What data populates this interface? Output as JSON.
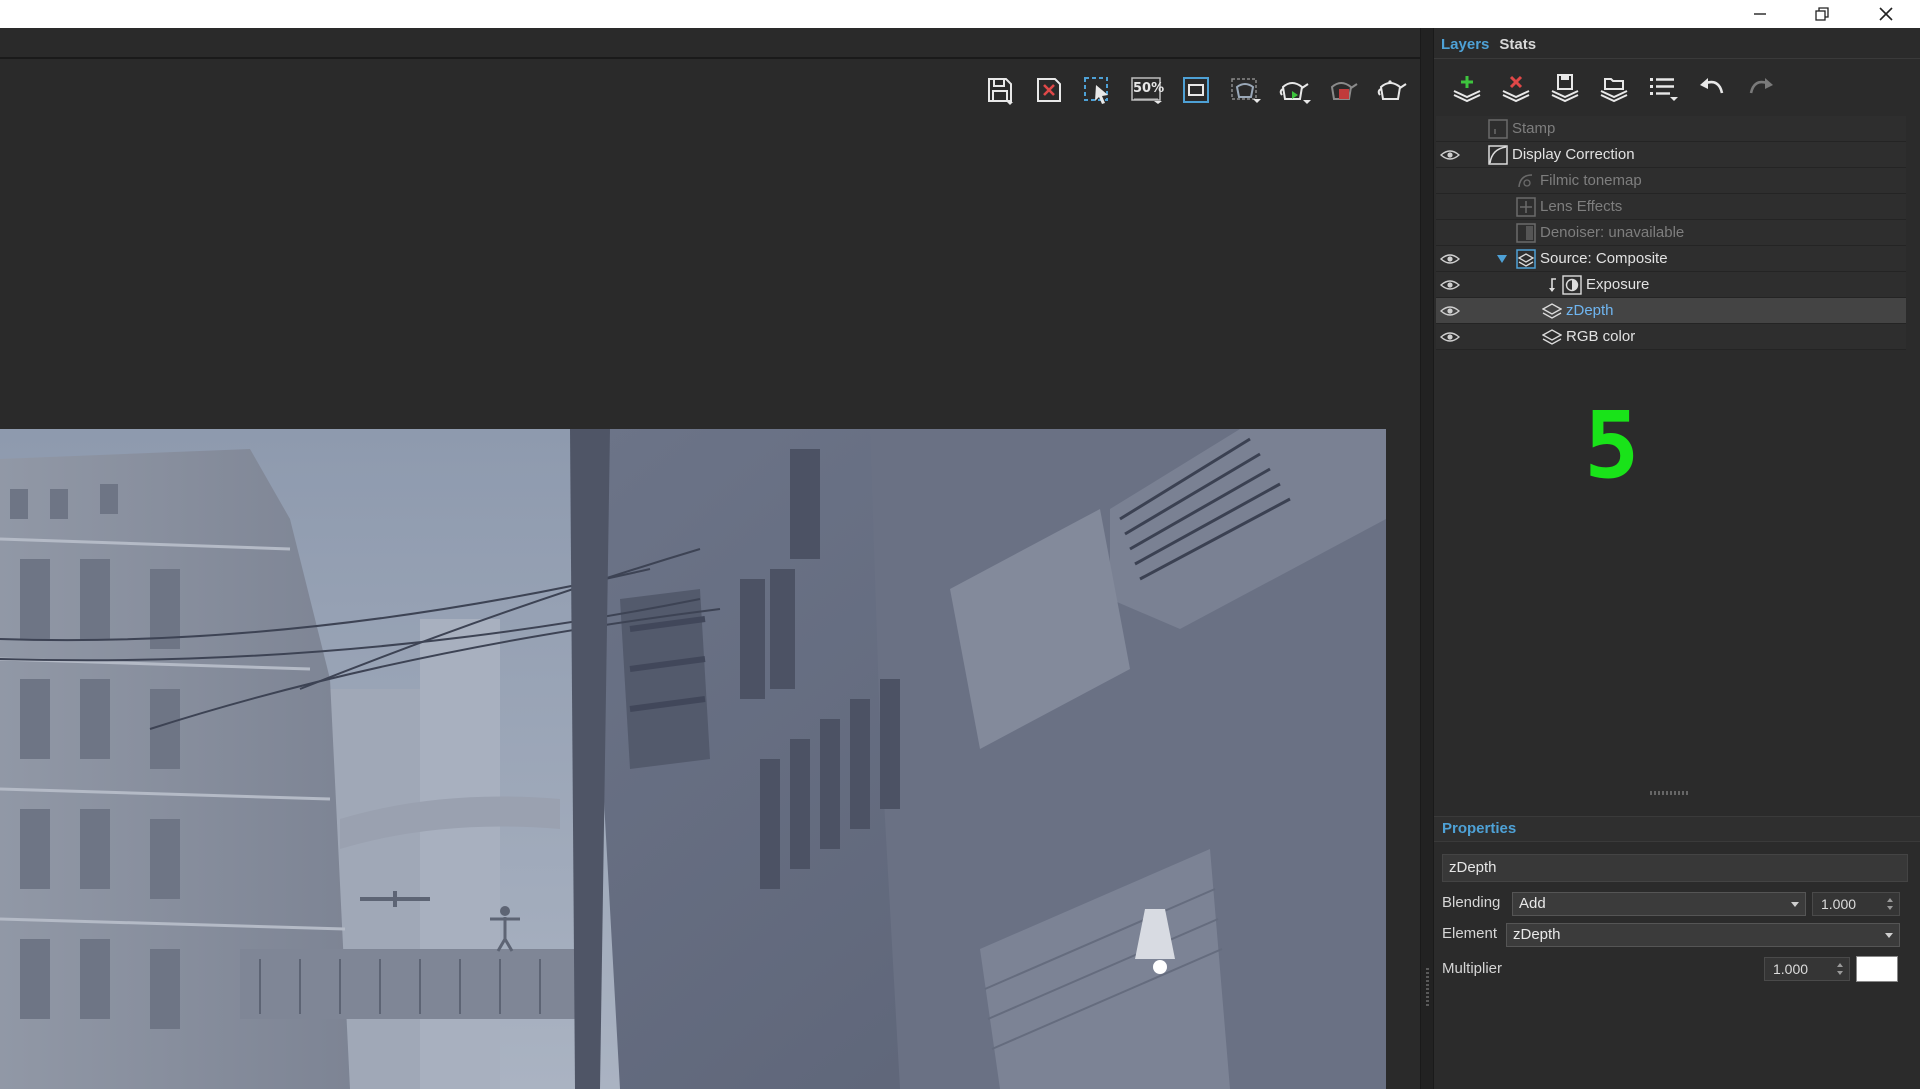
{
  "window": {
    "buttons": [
      "minimize-icon",
      "restore-icon",
      "close-icon"
    ]
  },
  "viewport": {
    "toolbar": [
      {
        "name": "save-image",
        "icon": "floppy-disk-icon"
      },
      {
        "name": "clear-image",
        "icon": "clear-icon"
      },
      {
        "name": "region-select",
        "icon": "region-select-icon"
      },
      {
        "name": "zoom",
        "label": "50%",
        "icon": "zoom-percent-icon"
      },
      {
        "name": "fit-frame",
        "icon": "frame-icon"
      },
      {
        "name": "render-region",
        "icon": "teapot-region-icon"
      },
      {
        "name": "render",
        "icon": "teapot-render-icon"
      },
      {
        "name": "stop-render",
        "icon": "teapot-stop-icon"
      },
      {
        "name": "render-options",
        "icon": "teapot-icon"
      }
    ]
  },
  "panel": {
    "tabs": [
      {
        "label": "Layers",
        "active": true
      },
      {
        "label": "Stats",
        "active": false
      }
    ],
    "layer_toolbar": [
      "add-layer-icon",
      "delete-layer-icon",
      "save-layers-icon",
      "load-layers-icon",
      "layer-list-icon",
      "undo-icon",
      "redo-icon"
    ],
    "layers": [
      {
        "label": "Stamp",
        "visible": false,
        "enabled": false,
        "icon": "stamp-icon"
      },
      {
        "label": "Display Correction",
        "visible": true,
        "enabled": true,
        "icon": "curve-icon"
      },
      {
        "label": "Filmic tonemap",
        "visible": false,
        "enabled": false,
        "icon": "tonemap-icon"
      },
      {
        "label": "Lens Effects",
        "visible": false,
        "enabled": false,
        "icon": "lens-effects-icon"
      },
      {
        "label": "Denoiser: unavailable",
        "visible": false,
        "enabled": false,
        "icon": "denoiser-icon"
      },
      {
        "label": "Source: Composite",
        "visible": true,
        "enabled": true,
        "icon": "composite-icon",
        "expanded": true
      },
      {
        "label": "Exposure",
        "visible": true,
        "enabled": true,
        "icon": "exposure-icon"
      },
      {
        "label": "zDepth",
        "visible": true,
        "enabled": true,
        "icon": "layer-icon",
        "selected": true
      },
      {
        "label": "RGB color",
        "visible": true,
        "enabled": true,
        "icon": "layer-icon"
      }
    ],
    "overlay_number": "5",
    "properties": {
      "title": "Properties",
      "layer_name": "zDepth",
      "blending_label": "Blending",
      "blending_value": "Add",
      "blending_amount": "1.000",
      "element_label": "Element",
      "element_value": "zDepth",
      "multiplier_label": "Multiplier",
      "multiplier_value": "1.000",
      "color": "#ffffff"
    }
  },
  "colors": {
    "accent": "#4ea1d6",
    "overlay_green": "#19e319",
    "background": "#2a2a2a"
  }
}
